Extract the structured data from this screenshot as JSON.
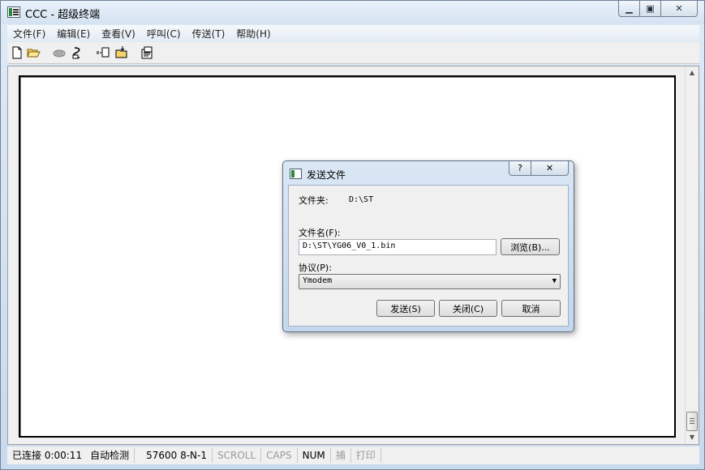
{
  "window": {
    "title": "CCC - 超级终端"
  },
  "menu": [
    {
      "label": "文件(F)"
    },
    {
      "label": "编辑(E)"
    },
    {
      "label": "查看(V)"
    },
    {
      "label": "呼叫(C)"
    },
    {
      "label": "传送(T)"
    },
    {
      "label": "帮助(H)"
    }
  ],
  "toolbar": [
    {
      "icon": "new-document-icon"
    },
    {
      "icon": "open-folder-icon"
    },
    {
      "icon": "call-icon"
    },
    {
      "icon": "disconnect-icon"
    },
    {
      "icon": "send-file-icon"
    },
    {
      "icon": "receive-file-icon"
    },
    {
      "icon": "properties-icon"
    }
  ],
  "statusbar": {
    "connection": "已连接 0:00:11",
    "detect": "自动检测",
    "port_settings": "57600 8-N-1",
    "scroll": "SCROLL",
    "caps": "CAPS",
    "num": "NUM",
    "capture": "捕",
    "print": "打印"
  },
  "dialog": {
    "title": "发送文件",
    "help_symbol": "?",
    "close_symbol": "✕",
    "folder_label": "文件夹:",
    "folder_value": "D:\\ST",
    "filename_label": "文件名(F):",
    "filename_value": "D:\\ST\\YG06_V0_1.bin",
    "browse_label": "浏览(B)...",
    "protocol_label": "协议(P):",
    "protocol_value": "Ymodem",
    "send_label": "发送(S)",
    "close_label": "关闭(C)",
    "cancel_label": "取消"
  }
}
